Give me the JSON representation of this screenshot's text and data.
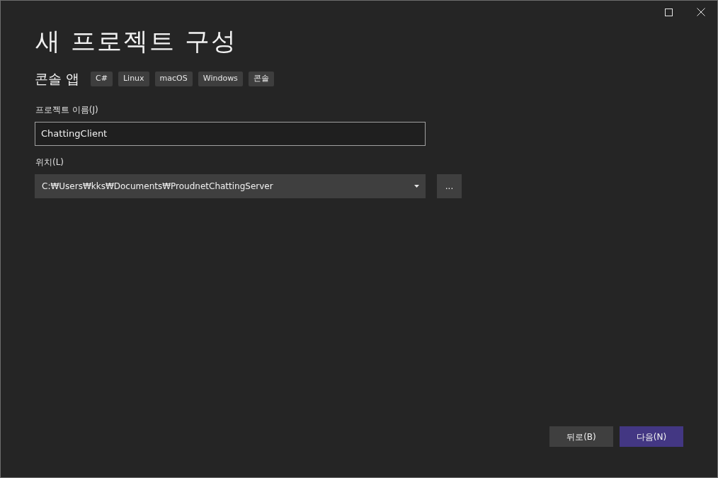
{
  "window": {
    "title": "새 프로젝트 구성"
  },
  "template": {
    "name": "콘솔 앱",
    "tags": [
      "C#",
      "Linux",
      "macOS",
      "Windows",
      "콘솔"
    ]
  },
  "project_name": {
    "label": "프로젝트 이름(J)",
    "value": "ChattingClient"
  },
  "location": {
    "label": "위치(L)",
    "value": "C:₩Users₩kks₩Documents₩ProudnetChattingServer",
    "browse": "..."
  },
  "buttons": [
    {
      "label": "뒤로(B)",
      "kind": "secondary"
    },
    {
      "label": "다음(N)",
      "kind": "primary"
    }
  ]
}
